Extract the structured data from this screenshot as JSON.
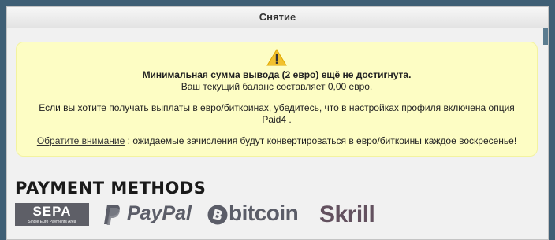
{
  "panel": {
    "title": "Снятие"
  },
  "notice": {
    "icon": "warning-icon",
    "heading": "Минимальная сумма вывода (2 евро) ещё не достигнута.",
    "balance_text": "Ваш текущий баланс составляет 0,00 евро.",
    "settings_text_line1": "Если вы хотите получать выплаты в евро/биткоинах, убедитесь, что в настройках профиля включена опция",
    "settings_text_line2": "Paid4 .",
    "attention_link": "Обратите внимание",
    "attention_text": " : ожидаемые зачисления будут конвертироваться в евро/биткоины каждое воскресенье!"
  },
  "payment_methods": {
    "title": "PAYMENT METHODS",
    "sepa": {
      "name": "SEPA",
      "subtitle": "Single Euro Payments Area"
    },
    "paypal": {
      "name": "PayPal"
    },
    "bitcoin": {
      "name": "bitcoin"
    },
    "skrill": {
      "name": "Skrill"
    }
  },
  "colors": {
    "background": "#3f5f75",
    "notice_bg": "#fdfdc4",
    "logo_gray": "#5b5d68",
    "skrill": "#63515f"
  }
}
